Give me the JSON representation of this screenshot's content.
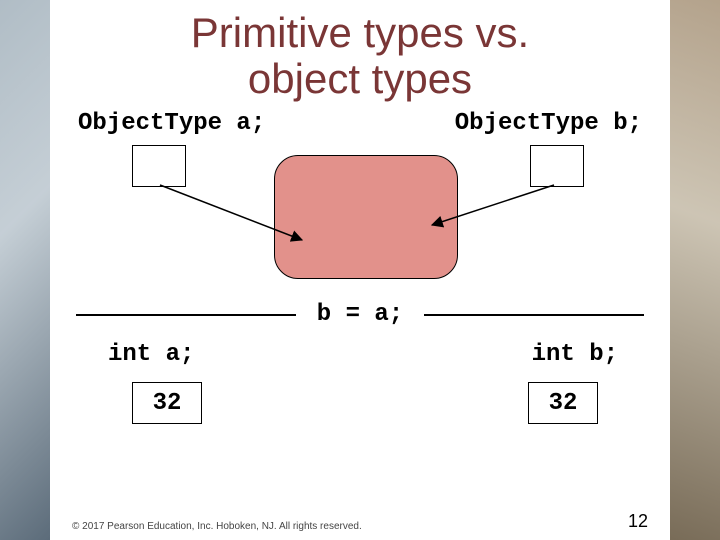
{
  "title_line1": "Primitive types vs.",
  "title_line2": "object types",
  "decl": {
    "a": "ObjectType a;",
    "b": "ObjectType b;"
  },
  "assignment": "b = a;",
  "int_decl": {
    "a": "int a;",
    "b": "int b;"
  },
  "values": {
    "a": "32",
    "b": "32"
  },
  "copyright": "© 2017 Pearson Education, Inc. Hoboken, NJ. All rights reserved.",
  "page_number": "12",
  "chart_data": {
    "type": "diagram",
    "title": "Primitive types vs. object types",
    "description": "Two object references (a and b of ObjectType) point to the same shared boxed object. After executing b = a; for int, both int a and int b separately hold the copied value 32.",
    "object_refs": [
      {
        "var": "a",
        "decl": "ObjectType a;",
        "points_to": "shared_object"
      },
      {
        "var": "b",
        "decl": "ObjectType b;",
        "points_to": "shared_object"
      }
    ],
    "primitive_vars": [
      {
        "var": "a",
        "decl": "int a;",
        "value": 32
      },
      {
        "var": "b",
        "decl": "int b;",
        "value": 32
      }
    ],
    "assignment_shown": "b = a;"
  }
}
